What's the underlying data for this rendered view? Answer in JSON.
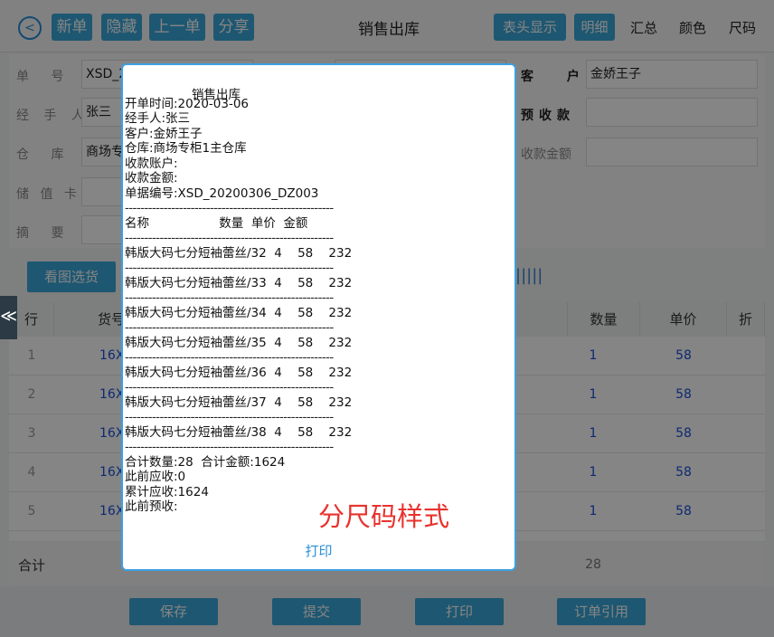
{
  "toolbar": {
    "back_glyph": "<",
    "new_label": "新单",
    "hide_label": "隐藏",
    "prev_label": "上一单",
    "share_label": "分享",
    "title": "销售出库",
    "header_display_label": "表头显示",
    "detail_label": "明细",
    "summary_label": "汇总",
    "color_label": "颜色",
    "size_label": "尺码"
  },
  "form": {
    "order_no_label": "单 号",
    "order_no_value": "XSD_2",
    "handler_label": "经 手 人",
    "handler_value": "张三",
    "warehouse_label": "仓 库",
    "warehouse_value": "商场专",
    "stored_card_label": "储 值 卡",
    "remark_label": "摘 要",
    "customer_label": "客 户",
    "customer_value": "金娇王子",
    "prepaid_label": "预收款",
    "received_label": "收款金额"
  },
  "view_pick_label": "看图选货",
  "barcode_glyph": "|||||",
  "table": {
    "headers": [
      "行",
      "货号",
      "数量",
      "单价",
      "折"
    ],
    "rows": [
      {
        "n": "1",
        "code": "16X",
        "qty": "1",
        "price": "58"
      },
      {
        "n": "2",
        "code": "16X",
        "qty": "1",
        "price": "58"
      },
      {
        "n": "3",
        "code": "16X",
        "qty": "1",
        "price": "58"
      },
      {
        "n": "4",
        "code": "16X",
        "qty": "1",
        "price": "58"
      },
      {
        "n": "5",
        "code": "16X",
        "qty": "1",
        "price": "58"
      }
    ],
    "total_label": "合计",
    "total_qty": "28"
  },
  "side_tab_glyph": "≪",
  "footer": {
    "save": "保存",
    "submit": "提交",
    "print": "打印",
    "order_ref": "订单引用"
  },
  "dialog": {
    "title": "销售出库",
    "open_time": "开单时间:2020-03-06",
    "handler": "经手人:张三",
    "customer": "客户:金娇王子",
    "warehouse": "仓库:商场专柜1主仓库",
    "account": "收款账户:",
    "amount": "收款金额:",
    "doc_no": "单据编号:XSD_20200306_DZ003",
    "dash": "------------------------------------------------------",
    "col_header": "名称                  数量  单价  金额",
    "items": [
      "韩版大码七分短袖蕾丝/32  4    58    232",
      "韩版大码七分短袖蕾丝/33  4    58    232",
      "韩版大码七分短袖蕾丝/34  4    58    232",
      "韩版大码七分短袖蕾丝/35  4    58    232",
      "韩版大码七分短袖蕾丝/36  4    58    232",
      "韩版大码七分短袖蕾丝/37  4    58    232",
      "韩版大码七分短袖蕾丝/38  4    58    232"
    ],
    "totals": "合计数量:28  合计金额:1624",
    "prev_receivable": "此前应收:0",
    "cum_receivable": "累计应收:1624",
    "prev_prepaid": "此前预收:",
    "stamp": "分尺码样式",
    "print_label": "打印"
  }
}
